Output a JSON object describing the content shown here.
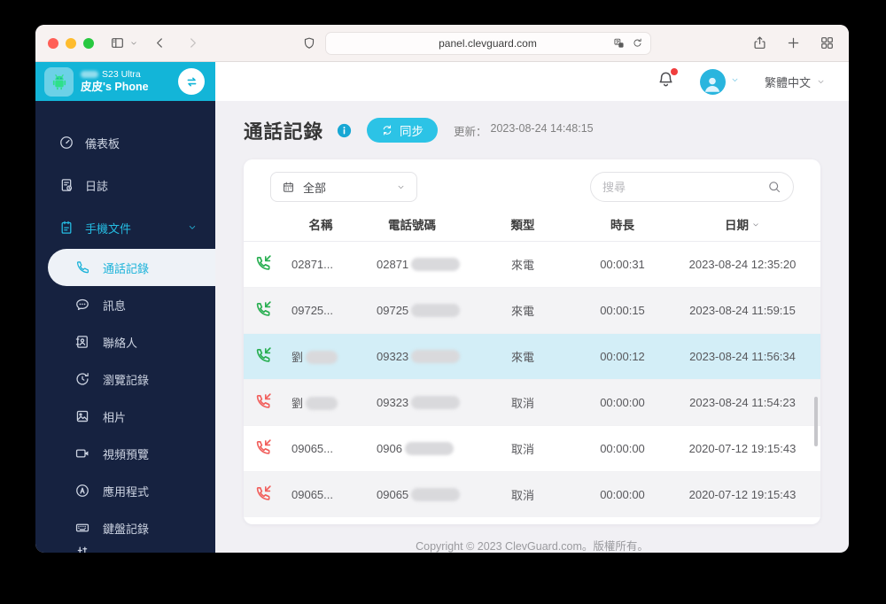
{
  "browser": {
    "url": "panel.clevguard.com"
  },
  "device": {
    "model": "S23 Ultra",
    "model_prefix_blurred": true,
    "name": "皮皮's Phone"
  },
  "header": {
    "language": "繁體中文"
  },
  "sidebar": {
    "items": [
      {
        "id": "dashboard",
        "icon": "gauge",
        "label": "儀表板",
        "level": "top"
      },
      {
        "id": "logs",
        "icon": "journal",
        "label": "日誌",
        "level": "top"
      },
      {
        "id": "phone-files",
        "icon": "files",
        "label": "手機文件",
        "level": "top",
        "active": true,
        "chevron": true
      },
      {
        "id": "call-records",
        "icon": "phone",
        "label": "通話記錄",
        "level": "sub",
        "selected": true
      },
      {
        "id": "messages",
        "icon": "message",
        "label": "訊息",
        "level": "sub"
      },
      {
        "id": "contacts",
        "icon": "contacts",
        "label": "聯絡人",
        "level": "sub"
      },
      {
        "id": "browsing-history",
        "icon": "history",
        "label": "瀏覽記錄",
        "level": "sub"
      },
      {
        "id": "photos",
        "icon": "photo",
        "label": "相片",
        "level": "sub"
      },
      {
        "id": "video-preview",
        "icon": "video",
        "label": "視頻預覽",
        "level": "sub"
      },
      {
        "id": "apps",
        "icon": "apps",
        "label": "應用程式",
        "level": "sub"
      },
      {
        "id": "keyboard-records",
        "icon": "keyboard",
        "label": "鍵盤記錄",
        "level": "sub"
      },
      {
        "id": "more-partial",
        "icon": "sliders",
        "label": "",
        "level": "sub",
        "partial": true
      }
    ]
  },
  "main": {
    "title": "通話記錄",
    "sync_label": "同步",
    "updated_label": "更新：",
    "updated_time": "2023-08-24 14:48:15",
    "filter_value": "全部",
    "search_placeholder": "搜尋",
    "table": {
      "columns": [
        "名稱",
        "電話號碼",
        "類型",
        "時長",
        "日期"
      ],
      "rows": [
        {
          "direction": "incoming",
          "name": "02871...",
          "name_blurred": false,
          "phone_prefix": "02871",
          "phone_blurred": true,
          "type": "來電",
          "duration": "00:00:31",
          "date": "2023-08-24 12:35:20",
          "highlight": false
        },
        {
          "direction": "incoming",
          "name": "09725...",
          "name_blurred": false,
          "phone_prefix": "09725",
          "phone_blurred": true,
          "type": "來電",
          "duration": "00:00:15",
          "date": "2023-08-24 11:59:15",
          "highlight": false
        },
        {
          "direction": "incoming",
          "name": "劉",
          "name_blurred": true,
          "phone_prefix": "09323",
          "phone_blurred": true,
          "type": "來電",
          "duration": "00:00:12",
          "date": "2023-08-24 11:56:34",
          "highlight": true
        },
        {
          "direction": "cancelled",
          "name": "劉",
          "name_blurred": true,
          "phone_prefix": "09323",
          "phone_blurred": true,
          "type": "取消",
          "duration": "00:00:00",
          "date": "2023-08-24 11:54:23",
          "highlight": false
        },
        {
          "direction": "cancelled",
          "name": "09065...",
          "name_blurred": false,
          "phone_prefix": "0906",
          "phone_blurred": true,
          "type": "取消",
          "duration": "00:00:00",
          "date": "2020-07-12 19:15:43",
          "highlight": false
        },
        {
          "direction": "cancelled",
          "name": "09065...",
          "name_blurred": false,
          "phone_prefix": "09065",
          "phone_blurred": true,
          "type": "取消",
          "duration": "00:00:00",
          "date": "2020-07-12 19:15:43",
          "highlight": false
        }
      ]
    }
  },
  "footer": {
    "text": "Copyright © 2023 ClevGuard.com。版權所有。"
  },
  "colors": {
    "accent_teal": "#13b5d8",
    "sync_button": "#2cc3e6",
    "sidebar_bg": "#162240",
    "incoming_green": "#27ae50",
    "cancelled_red": "#f15f5c",
    "highlight_row": "#d3eef7",
    "traffic_red": "#ff5f57",
    "traffic_yellow": "#febc2e",
    "traffic_green": "#28c840"
  }
}
